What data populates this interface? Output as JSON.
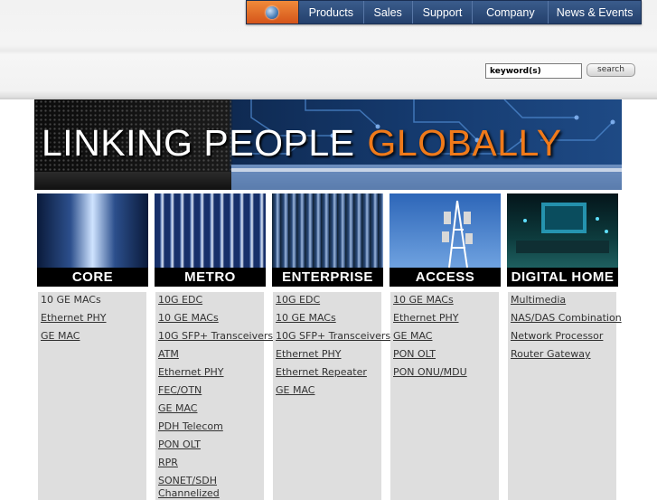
{
  "nav": {
    "items": [
      "Products",
      "Sales",
      "Support",
      "Company",
      "News & Events"
    ]
  },
  "search": {
    "placeholder": "keyword(s)",
    "button_label": "search"
  },
  "banner": {
    "text_part1": "LINKING PEOPLE",
    "text_part2": "GLOBALLY"
  },
  "categories": [
    {
      "label": "CORE",
      "items": [
        "10 GE MACs",
        "Ethernet PHY",
        "GE MAC"
      ]
    },
    {
      "label": "METRO",
      "items": [
        "10G EDC",
        "10 GE MACs",
        "10G SFP+ Transceivers",
        "ATM",
        "Ethernet PHY",
        "FEC/OTN",
        "GE MAC",
        "PDH Telecom",
        "PON OLT",
        "RPR",
        "SONET/SDH",
        "Channelized"
      ]
    },
    {
      "label": "ENTERPRISE",
      "items": [
        "10G EDC",
        "10 GE MACs",
        "10G SFP+ Transceivers",
        "Ethernet PHY",
        "Ethernet Repeater",
        "GE MAC"
      ]
    },
    {
      "label": "ACCESS",
      "items": [
        "10 GE MACs",
        "Ethernet PHY",
        "GE MAC",
        "PON OLT",
        "PON ONU/MDU"
      ]
    },
    {
      "label": "DIGITAL HOME",
      "items": [
        "Multimedia",
        "NAS/DAS Combination",
        "Network Processor",
        "Router Gateway"
      ]
    }
  ],
  "colors": {
    "nav_bg": "#2f4f80",
    "nav_home": "#e8682a",
    "banner_accent": "#f07a1a",
    "link_column_bg": "#dedede"
  }
}
